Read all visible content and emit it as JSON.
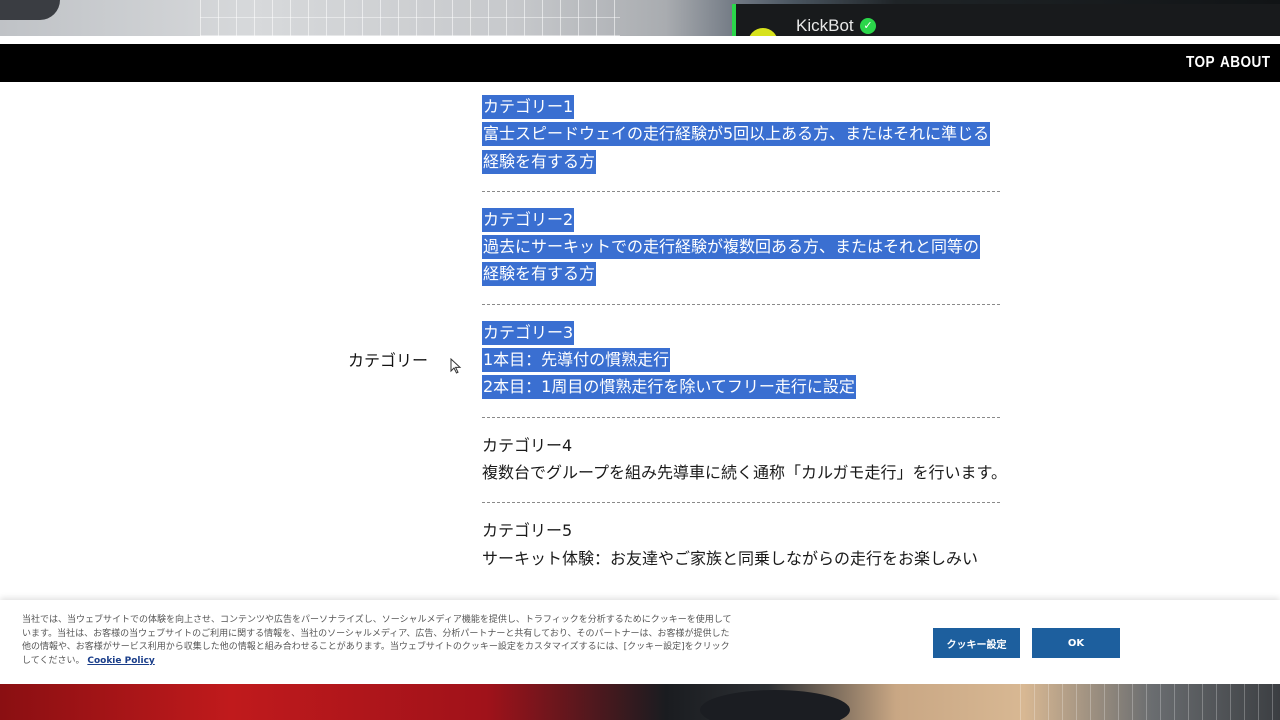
{
  "stream": {
    "chat_name": "KickBot",
    "verified_glyph": "✓",
    "accent": "#2bd64a"
  },
  "nav": {
    "top": "TOP",
    "about": "ABOUT"
  },
  "section": {
    "label": "カテゴリー",
    "categories": [
      {
        "lines": [
          "カテゴリー1",
          "富士スピードウェイの走行経験が5回以上ある方、またはそれに準じる",
          "経験を有する方"
        ],
        "selected": true
      },
      {
        "lines": [
          "カテゴリー2",
          "過去にサーキットでの走行経験が複数回ある方、またはそれと同等の",
          "経験を有する方"
        ],
        "selected": true
      },
      {
        "lines": [
          "カテゴリー3",
          "1本目：先導付の慣熟走行",
          "2本目：1周目の慣熟走行を除いてフリー走行に設定"
        ],
        "selected": true
      },
      {
        "lines": [
          "カテゴリー4",
          "複数台でグループを組み先導車に続く通称「カルガモ走行」を行います。"
        ],
        "selected": false
      },
      {
        "lines": [
          "カテゴリー5",
          "サーキット体験：お友達やご家族と同乗しながらの走行をお楽しみい"
        ],
        "selected": false
      }
    ],
    "selection_color": "#3a6fd1"
  },
  "cookie": {
    "text": "当社では、当ウェブサイトでの体験を向上させ、コンテンツや広告をパーソナライズし、ソーシャルメディア機能を提供し、トラフィックを分析するためにクッキーを使用しています。当社は、お客様の当ウェブサイトのご利用に関する情報を、当社のソーシャルメディア、広告、分析パートナーと共有しており、そのパートナーは、お客様が提供した他の情報や、お客様がサービス利用から収集した他の情報と組み合わせることがあります。当ウェブサイトのクッキー設定をカスタマイズするには、[クッキー設定]をクリックしてください。",
    "policy_link": "Cookie Policy",
    "settings_button": "クッキー設定",
    "ok_button": "OK",
    "button_color": "#1d5f9e"
  }
}
